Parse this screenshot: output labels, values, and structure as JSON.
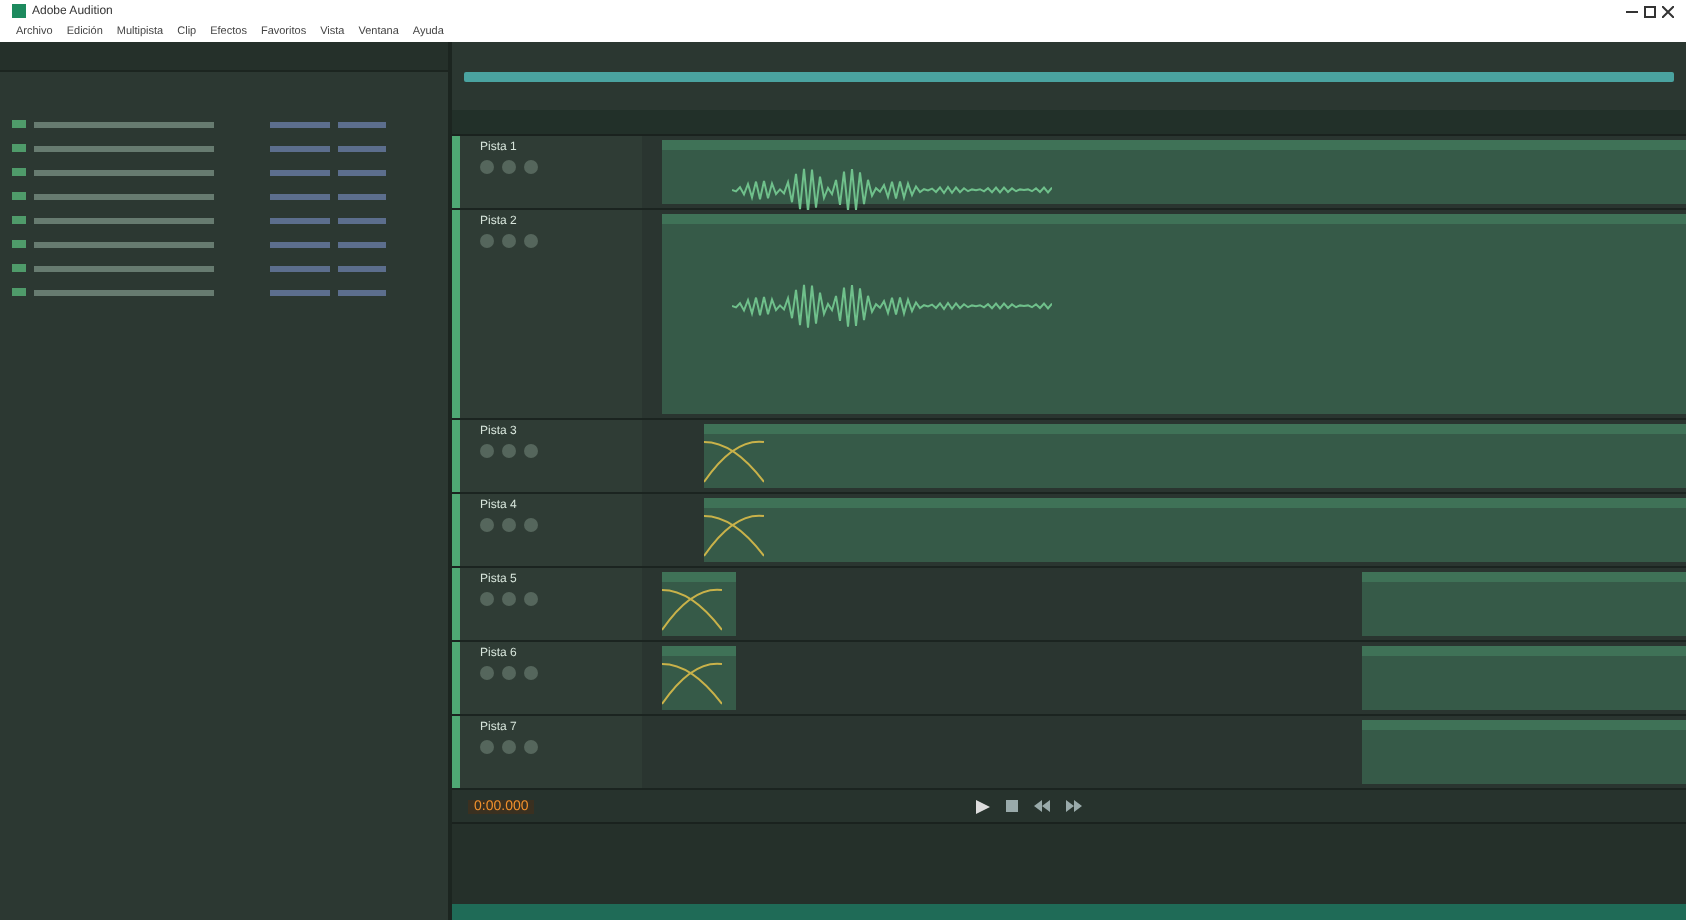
{
  "window": {
    "title": "Adobe Audition"
  },
  "menu": [
    "Archivo",
    "Edición",
    "Multipista",
    "Clip",
    "Efectos",
    "Favoritos",
    "Vista",
    "Ventana",
    "Ayuda"
  ],
  "tracks": [
    {
      "name": "Pista 1",
      "kind": "normal"
    },
    {
      "name": "Pista 2",
      "kind": "tall"
    },
    {
      "name": "Pista 3",
      "kind": "normal"
    },
    {
      "name": "Pista 4",
      "kind": "normal"
    },
    {
      "name": "Pista 5",
      "kind": "normal"
    },
    {
      "name": "Pista 6",
      "kind": "normal"
    },
    {
      "name": "Pista 7",
      "kind": "normal"
    }
  ],
  "transport": {
    "time": "0:00.000"
  }
}
